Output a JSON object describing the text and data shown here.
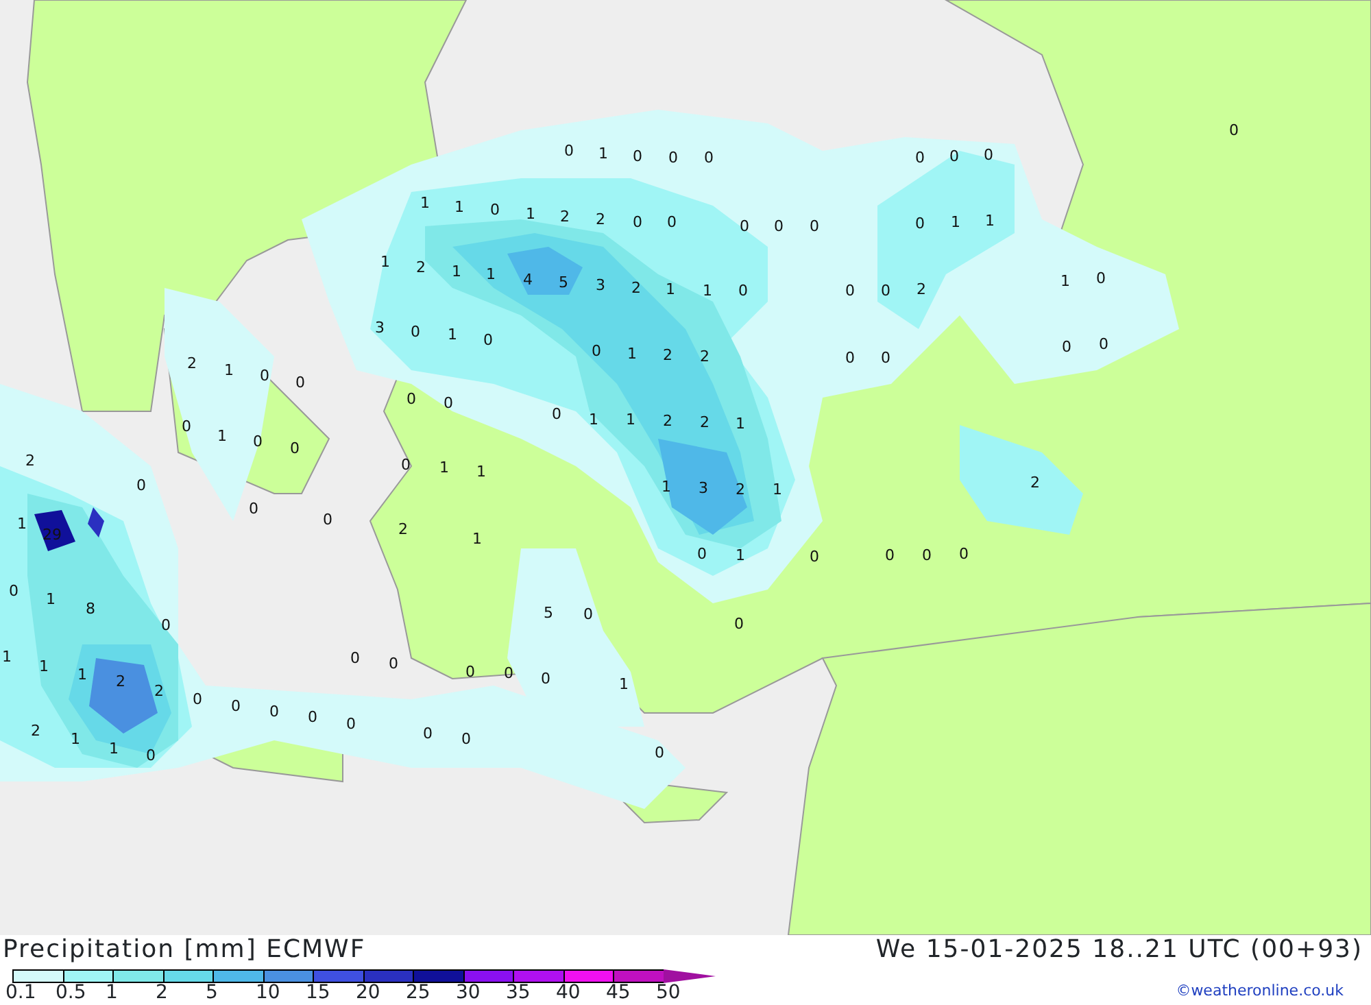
{
  "map": {
    "labels": [
      "0",
      "1",
      "0",
      "0",
      "0",
      "0",
      "0",
      "0",
      "0",
      "1",
      "1",
      "0",
      "1",
      "2",
      "2",
      "0",
      "0",
      "0",
      "0",
      "0",
      "0",
      "1",
      "1",
      "1",
      "2",
      "1",
      "1",
      "4",
      "5",
      "3",
      "2",
      "1",
      "1",
      "0",
      "0",
      "0",
      "2",
      "1",
      "0",
      "3",
      "0",
      "1",
      "0",
      "0",
      "1",
      "2",
      "2",
      "0",
      "0",
      "0",
      "0",
      "2",
      "1",
      "0",
      "0",
      "0",
      "1",
      "0",
      "0",
      "0",
      "0",
      "0",
      "1",
      "1",
      "2",
      "2",
      "1",
      "2",
      "0",
      "0",
      "1",
      "1",
      "1",
      "3",
      "2",
      "1",
      "2",
      "0",
      "1",
      "29",
      "0",
      "2",
      "1",
      "0",
      "1",
      "0",
      "0",
      "0",
      "0",
      "0",
      "1",
      "8",
      "0",
      "5",
      "0",
      "0",
      "1",
      "1",
      "1",
      "2",
      "2",
      "0",
      "0",
      "0",
      "0",
      "0",
      "1",
      "2",
      "1",
      "1",
      "0",
      "0",
      "0",
      "0",
      "0",
      "0",
      "0",
      "0",
      "0"
    ]
  },
  "legend": {
    "title": "Precipitation [mm] ECMWF",
    "datetime": "We 15-01-2025 18..21 UTC (00+93)",
    "credit": "©weatheronline.co.uk",
    "scale": [
      {
        "label": "0.1",
        "color": "#d4fafa"
      },
      {
        "label": "0.5",
        "color": "#a0f5f5"
      },
      {
        "label": "1",
        "color": "#80e8e8"
      },
      {
        "label": "2",
        "color": "#66d9e8"
      },
      {
        "label": "5",
        "color": "#4fb8e8"
      },
      {
        "label": "10",
        "color": "#4a90e0"
      },
      {
        "label": "15",
        "color": "#3f50e0"
      },
      {
        "label": "20",
        "color": "#2a30c0"
      },
      {
        "label": "25",
        "color": "#10109a"
      },
      {
        "label": "30",
        "color": "#8a10f0"
      },
      {
        "label": "35",
        "color": "#b010f0"
      },
      {
        "label": "40",
        "color": "#f010f0"
      },
      {
        "label": "45",
        "color": "#c010c0"
      },
      {
        "label": "50",
        "color": "#a010a0"
      }
    ]
  }
}
